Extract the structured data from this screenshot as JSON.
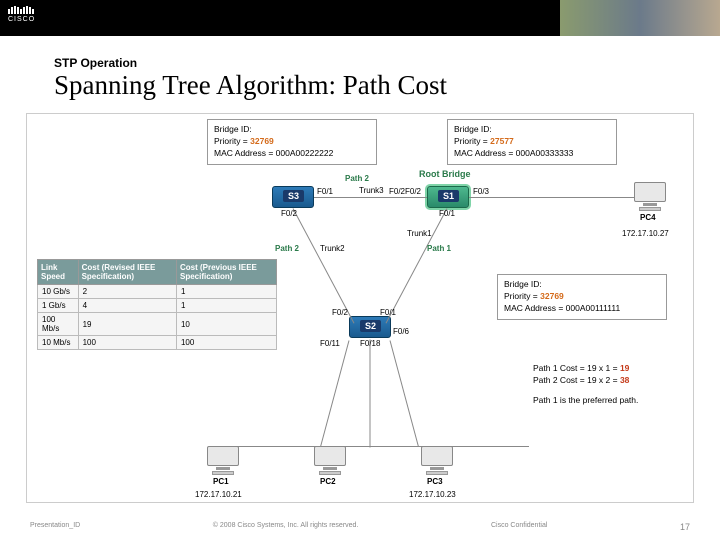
{
  "header": {
    "subtitle": "STP Operation",
    "title": "Spanning Tree Algorithm: Path Cost"
  },
  "bridge": {
    "s3": {
      "l1": "Bridge ID:",
      "l2": "Priority = ",
      "p": "32769",
      "l3": "MAC Address = 000A00222222"
    },
    "s1": {
      "l1": "Bridge ID:",
      "l2": "Priority = ",
      "p": "27577",
      "l3": "MAC Address = 000A00333333"
    },
    "s2": {
      "l1": "Bridge ID:",
      "l2": "Priority = ",
      "p": "32769",
      "l3": "MAC Address = 000A00111111"
    }
  },
  "table": {
    "h1": "Link Speed",
    "h2": "Cost (Revised IEEE Specification)",
    "h3": "Cost (Previous IEEE Specification)",
    "rows": [
      {
        "a": "10 Gb/s",
        "b": "2",
        "c": "1"
      },
      {
        "a": "1 Gb/s",
        "b": "4",
        "c": "1"
      },
      {
        "a": "100 Mb/s",
        "b": "19",
        "c": "10"
      },
      {
        "a": "10 Mb/s",
        "b": "100",
        "c": "100"
      }
    ]
  },
  "labels": {
    "rootbridge": "Root Bridge",
    "path2a": "Path 2",
    "path2b": "Path 2",
    "path1": "Path 1",
    "trunk1": "Trunk1",
    "trunk2": "Trunk2",
    "trunk3": "Trunk3",
    "s1": "S1",
    "s2": "S2",
    "s3": "S3",
    "pc1": "PC1",
    "pc2": "PC2",
    "pc3": "PC3",
    "pc4": "PC4",
    "ip1": "172.17.10.21",
    "ip2": " ",
    "ip3": "172.17.10.23",
    "ip4": "172.17.10.27",
    "f01": "F0/1",
    "f02": "F0/2",
    "f03": "F0/3",
    "f06": "F0/6",
    "f011": "F0/11",
    "f018": "F0/18"
  },
  "calc": {
    "l1a": "Path 1 Cost = 19 x 1 = ",
    "l1b": "19",
    "l2a": "Path 2 Cost = 19 x 2 = ",
    "l2b": "38",
    "pref": "Path 1 is the preferred path."
  },
  "footer": {
    "left": "Presentation_ID",
    "mid": "© 2008 Cisco Systems, Inc. All rights reserved.",
    "right": "Cisco Confidential",
    "page": "17"
  }
}
